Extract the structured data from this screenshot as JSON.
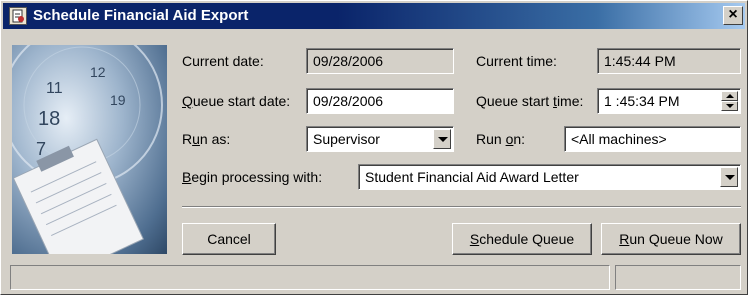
{
  "window": {
    "title": "Schedule Financial Aid Export",
    "close_glyph": "×"
  },
  "form": {
    "current_date": {
      "label": "Current date:",
      "value": "09/28/2006"
    },
    "current_time": {
      "label": "Current time:",
      "value": "1:45:44 PM"
    },
    "queue_start_date": {
      "label_pre": "",
      "label_ul": "Q",
      "label_post": "ueue start date:",
      "value": "09/28/2006"
    },
    "queue_start_time": {
      "label_pre": "Queue start ",
      "label_ul": "t",
      "label_post": "ime:",
      "value": "1 :45:34 PM"
    },
    "run_as": {
      "label_pre": "R",
      "label_ul": "u",
      "label_post": "n as:",
      "value": "Supervisor"
    },
    "run_on": {
      "label_pre": "Run ",
      "label_ul": "o",
      "label_post": "n:",
      "value": "<All machines>"
    },
    "begin_processing": {
      "label_pre": "",
      "label_ul": "B",
      "label_post": "egin processing with:",
      "value": "Student Financial Aid Award Letter"
    }
  },
  "buttons": {
    "cancel": "Cancel",
    "schedule_queue": {
      "ul": "S",
      "rest": "chedule Queue"
    },
    "run_queue_now": {
      "ul": "R",
      "rest": "un Queue Now"
    }
  },
  "icons": {
    "title": "schedule-icon",
    "close": "close-icon",
    "dropdown": "chevron-down-icon",
    "spin_up": "spin-up-icon",
    "spin_down": "spin-down-icon"
  }
}
